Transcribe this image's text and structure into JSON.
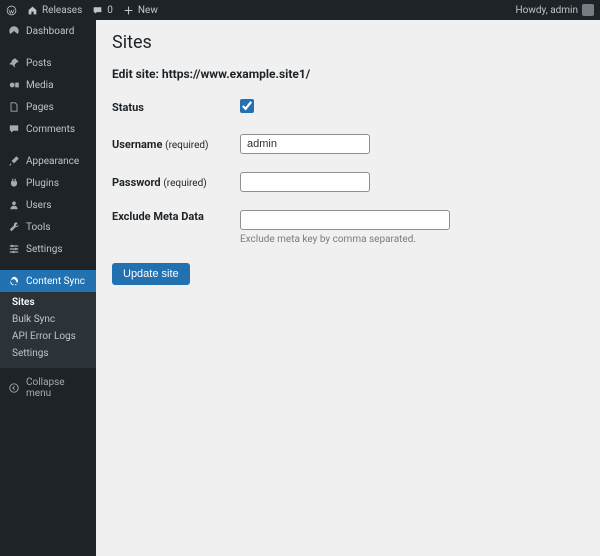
{
  "topbar": {
    "releases_label": "Releases",
    "comments_count": "0",
    "new_label": "New",
    "howdy": "Howdy, admin"
  },
  "sidebar": {
    "items": [
      {
        "label": "Dashboard",
        "icon": "dashboard"
      },
      {
        "label": "Posts",
        "icon": "pin"
      },
      {
        "label": "Media",
        "icon": "media"
      },
      {
        "label": "Pages",
        "icon": "pages"
      },
      {
        "label": "Comments",
        "icon": "comment"
      },
      {
        "label": "Appearance",
        "icon": "brush"
      },
      {
        "label": "Plugins",
        "icon": "plug"
      },
      {
        "label": "Users",
        "icon": "user"
      },
      {
        "label": "Tools",
        "icon": "wrench"
      },
      {
        "label": "Settings",
        "icon": "sliders"
      },
      {
        "label": "Content Sync",
        "icon": "sync"
      }
    ],
    "submenu": [
      {
        "label": "Sites",
        "current": true
      },
      {
        "label": "Bulk Sync"
      },
      {
        "label": "API Error Logs"
      },
      {
        "label": "Settings"
      }
    ],
    "collapse_label": "Collapse menu"
  },
  "page": {
    "title": "Sites",
    "subhead": "Edit site: https://www.example.site1/",
    "status_label": "Status",
    "status_checked": true,
    "username_label": "Username",
    "username_req": "(required)",
    "username_value": "admin",
    "password_label": "Password",
    "password_req": "(required)",
    "password_value": "",
    "exclude_label": "Exclude Meta Data",
    "exclude_value": "",
    "exclude_help": "Exclude meta key by comma separated.",
    "submit_label": "Update site"
  }
}
